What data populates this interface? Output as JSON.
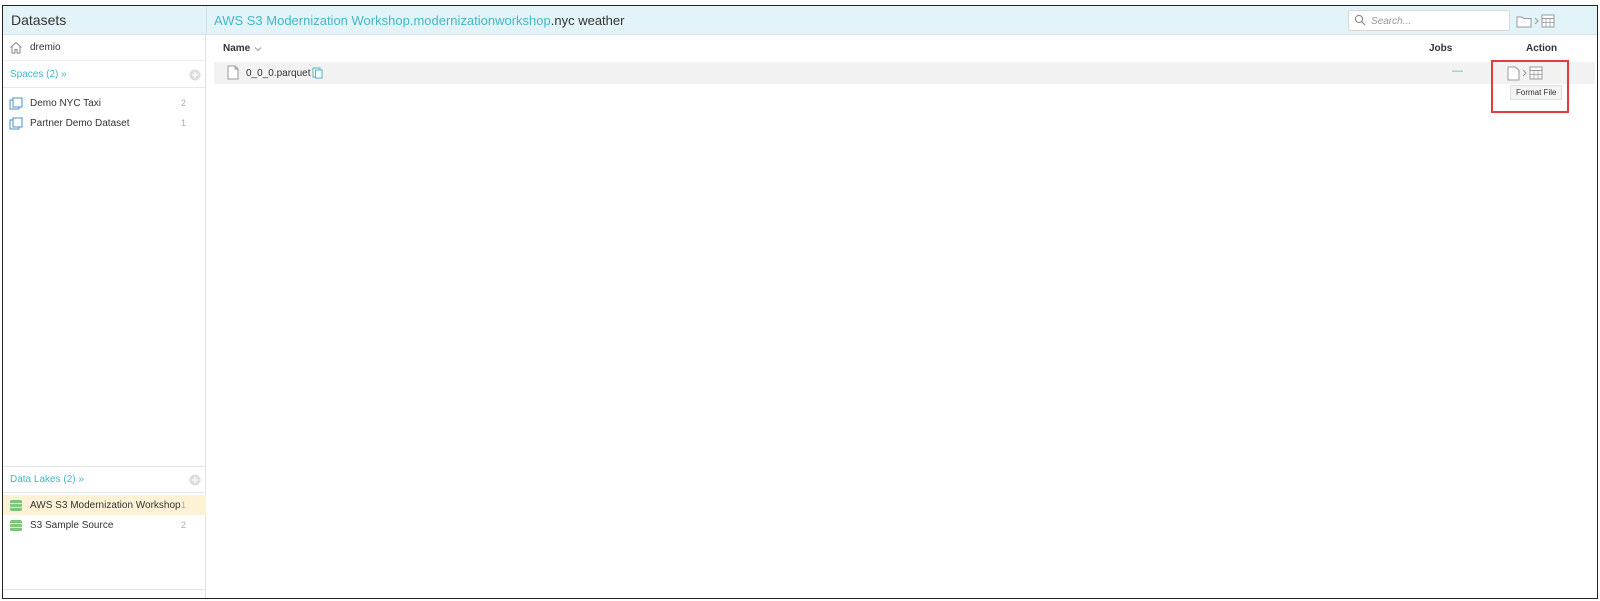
{
  "header": {
    "sidebar_title": "Datasets",
    "breadcrumb": {
      "part1": "AWS S3 Modernization Workshop",
      "sep1": ".",
      "part2": "modernizationworkshop",
      "sep2": ".",
      "current": "nyc weather"
    },
    "search": {
      "placeholder": "Search...",
      "value": ""
    }
  },
  "sidebar": {
    "home_label": "dremio",
    "spaces": {
      "heading": "Spaces (2) »",
      "items": [
        {
          "label": "Demo NYC Taxi",
          "count": "2"
        },
        {
          "label": "Partner Demo Dataset",
          "count": "1"
        }
      ]
    },
    "lakes": {
      "heading": "Data Lakes (2) »",
      "items": [
        {
          "label": "AWS S3 Modernization Workshop",
          "count": "1",
          "selected": true
        },
        {
          "label": "S3 Sample Source",
          "count": "2",
          "selected": false
        }
      ]
    }
  },
  "table": {
    "columns": {
      "name": "Name",
      "jobs": "Jobs",
      "action": "Action"
    },
    "rows": [
      {
        "name": "0_0_0.parquet",
        "jobs": "—"
      }
    ],
    "tooltip": "Format File"
  },
  "colors": {
    "accent": "#43b8c9",
    "header_bg": "#e3f4f8",
    "selected_bg": "#fdf2d6",
    "highlight": "#e53b3b",
    "source_icon": "#7cc576"
  },
  "icons": {
    "home": "home-icon",
    "search": "search-icon",
    "space": "space-icon",
    "source": "source-icon",
    "file": "file-icon",
    "copy": "copy-path-icon",
    "add": "add-icon",
    "format": "format-file-icon"
  }
}
